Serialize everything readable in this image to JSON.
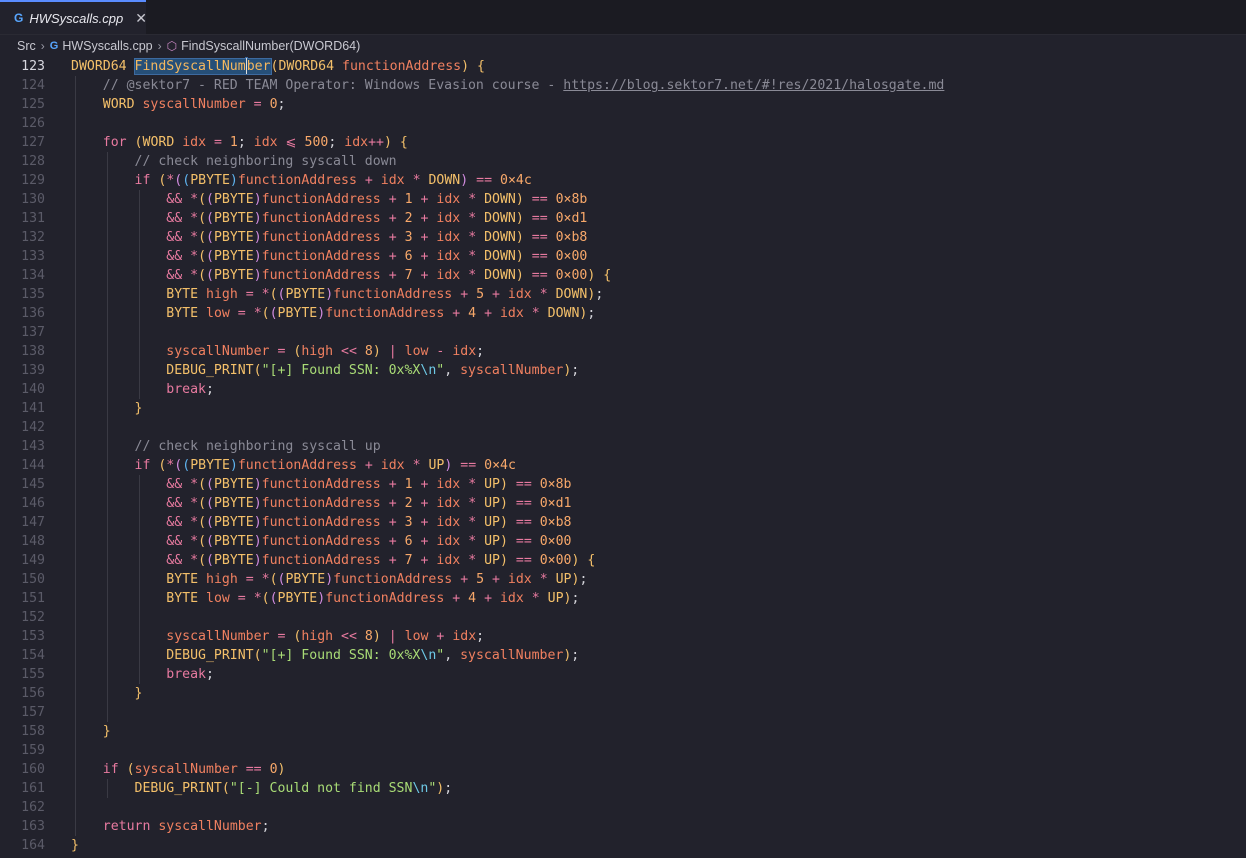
{
  "tab": {
    "title": "HWSyscalls.cpp",
    "icon": "cpp-file-icon",
    "close": "✕"
  },
  "breadcrumb": {
    "folder": "Src",
    "file": "HWSyscalls.cpp",
    "symbol": "FindSyscallNumber(DWORD64)"
  },
  "editor": {
    "active_line": "123",
    "highlight_color": "#264f78",
    "line_numbers": [
      "123",
      "124",
      "125",
      "126",
      "127",
      "128",
      "129",
      "130",
      "131",
      "132",
      "133",
      "134",
      "135",
      "136",
      "137",
      "138",
      "139",
      "140",
      "141",
      "142",
      "143",
      "144",
      "145",
      "146",
      "147",
      "148",
      "149",
      "150",
      "151",
      "152",
      "153",
      "154",
      "155",
      "156",
      "157",
      "158",
      "159",
      "160",
      "161",
      "162",
      "163",
      "164"
    ],
    "lines": [
      "DWORD64 FindSyscallNumber(DWORD64 functionAddress) {",
      "    // @sektor7 - RED TEAM Operator: Windows Evasion course - https://blog.sektor7.net/#!res/2021/halosgate.md",
      "    WORD syscallNumber = 0;",
      "",
      "    for (WORD idx = 1; idx ⩽ 500; idx++) {",
      "        // check neighboring syscall down",
      "        if (*((PBYTE)functionAddress + idx * DOWN) == 0x4c",
      "            && *((PBYTE)functionAddress + 1 + idx * DOWN) == 0x8b",
      "            && *((PBYTE)functionAddress + 2 + idx * DOWN) == 0xd1",
      "            && *((PBYTE)functionAddress + 3 + idx * DOWN) == 0xb8",
      "            && *((PBYTE)functionAddress + 6 + idx * DOWN) == 0x00",
      "            && *((PBYTE)functionAddress + 7 + idx * DOWN) == 0x00) {",
      "            BYTE high = *((PBYTE)functionAddress + 5 + idx * DOWN);",
      "            BYTE low = *((PBYTE)functionAddress + 4 + idx * DOWN);",
      "",
      "            syscallNumber = (high << 8) | low - idx;",
      "            DEBUG_PRINT(\"[+] Found SSN: 0x%X\\n\", syscallNumber);",
      "            break;",
      "        }",
      "",
      "        // check neighboring syscall up",
      "        if (*((PBYTE)functionAddress + idx * UP) == 0x4c",
      "            && *((PBYTE)functionAddress + 1 + idx * UP) == 0x8b",
      "            && *((PBYTE)functionAddress + 2 + idx * UP) == 0xd1",
      "            && *((PBYTE)functionAddress + 3 + idx * UP) == 0xb8",
      "            && *((PBYTE)functionAddress + 6 + idx * UP) == 0x00",
      "            && *((PBYTE)functionAddress + 7 + idx * UP) == 0x00) {",
      "            BYTE high = *((PBYTE)functionAddress + 5 + idx * UP);",
      "            BYTE low = *((PBYTE)functionAddress + 4 + idx * UP);",
      "",
      "            syscallNumber = (high << 8) | low + idx;",
      "            DEBUG_PRINT(\"[+] Found SSN: 0x%X\\n\", syscallNumber);",
      "            break;",
      "        }",
      "",
      "    }",
      "",
      "    if (syscallNumber == 0)",
      "        DEBUG_PRINT(\"[-] Could not find SSN\\n\");",
      "",
      "    return syscallNumber;",
      "}"
    ]
  }
}
